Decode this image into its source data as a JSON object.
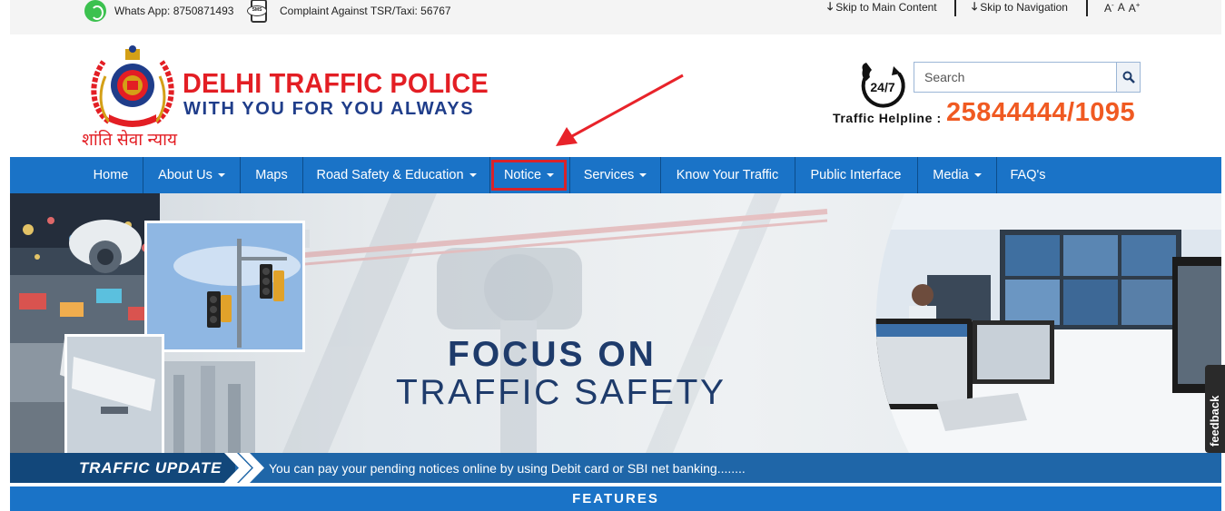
{
  "topbar": {
    "whatsapp_text": "Whats App: 8750871493",
    "complaint_text": "Complaint Against TSR/Taxi: 56767",
    "complaint_icon_text": "SMS",
    "skip_main": "Skip to Main Content",
    "skip_nav": "Skip to Navigation",
    "font_small": "A",
    "font_small_sup": "-",
    "font_normal": "A",
    "font_large": "A",
    "font_large_sup": "+"
  },
  "header": {
    "title": "DELHI TRAFFIC POLICE",
    "tagline": "WITH YOU FOR YOU ALWAYS",
    "hindi_motto": "शांति सेवा न्याय",
    "helpline_badge": "24/7",
    "helpline_label": "Traffic Helpline :",
    "helpline_number": "25844444/1095",
    "search_placeholder": "Search"
  },
  "nav": {
    "items": [
      {
        "label": "Home",
        "dropdown": false
      },
      {
        "label": "About Us",
        "dropdown": true
      },
      {
        "label": "Maps",
        "dropdown": false
      },
      {
        "label": "Road Safety & Education",
        "dropdown": true
      },
      {
        "label": "Notice",
        "dropdown": true,
        "highlighted": true
      },
      {
        "label": "Services",
        "dropdown": true
      },
      {
        "label": "Know Your Traffic",
        "dropdown": false
      },
      {
        "label": "Public Interface",
        "dropdown": false
      },
      {
        "label": "Media",
        "dropdown": true
      },
      {
        "label": "FAQ's",
        "dropdown": false
      }
    ]
  },
  "banner": {
    "line1": "FOCUS ON",
    "line2": "TRAFFIC SAFETY"
  },
  "ticker": {
    "label": "TRAFFIC UPDATE",
    "message": "You can pay your pending notices online by using Debit card or SBI net banking........"
  },
  "features": {
    "label": "FEATURES"
  },
  "feedback": {
    "label": "feedback"
  },
  "colors": {
    "nav_blue": "#1a73c7",
    "brand_red": "#e31e24",
    "brand_navy": "#1f3d8a",
    "helpline_orange": "#f05a22",
    "highlight_red": "#d9222a"
  }
}
